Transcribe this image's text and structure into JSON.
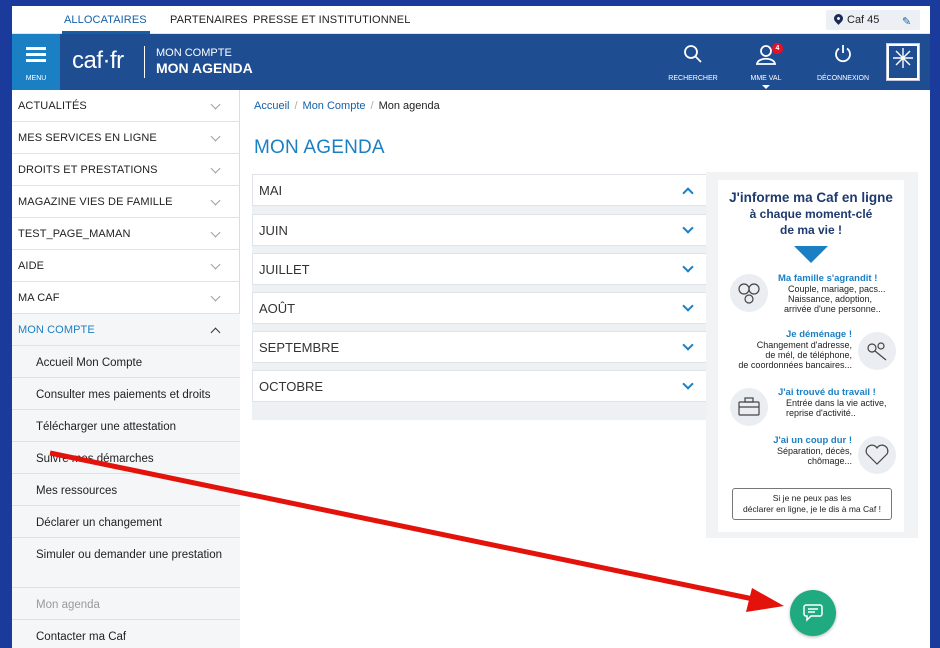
{
  "topbar": {
    "links": [
      "ALLOCATAIRES",
      "PARTENAIRES",
      "PRESSE ET INSTITUTIONNEL"
    ],
    "caf_selector": "Caf 45"
  },
  "header": {
    "menu_label": "MENU",
    "logo": "caf·fr",
    "subtitle": "MON COMPTE",
    "title": "MON AGENDA",
    "search_label": "RECHERCHER",
    "user_label": "MME VAL",
    "notif_count": "4",
    "logout_label": "DÉCONNEXION"
  },
  "sidebar": {
    "items": [
      "ACTUALITÉS",
      "MES SERVICES EN LIGNE",
      "DROITS ET PRESTATIONS",
      "MAGAZINE VIES DE FAMILLE",
      "TEST_PAGE_MAMAN",
      "AIDE",
      "MA CAF",
      "MON COMPTE"
    ],
    "subitems": [
      "Accueil Mon Compte",
      "Consulter mes paiements et droits",
      "Télécharger une attestation",
      "Suivre mes démarches",
      "Mes ressources",
      "Déclarer un changement",
      "Simuler ou demander une prestation",
      "Mon agenda",
      "Contacter ma Caf"
    ]
  },
  "breadcrumb": {
    "home": "Accueil",
    "account": "Mon Compte",
    "current": "Mon agenda"
  },
  "page_title": "MON AGENDA",
  "months": [
    "MAI",
    "JUIN",
    "JUILLET",
    "AOÛT",
    "SEPTEMBRE",
    "OCTOBRE"
  ],
  "promo": {
    "title_l1": "J'informe ma Caf en ligne",
    "title_l2": "à chaque moment-clé",
    "title_l3": "de ma vie !",
    "famille_title": "Ma famille s'agrandit !",
    "famille_l1": "Couple, mariage, pacs...",
    "famille_l2": "Naissance, adoption,",
    "famille_l3": "arrivée d'une personne..",
    "demenage_title": "Je déménage !",
    "demenage_l1": "Changement d'adresse,",
    "demenage_l2": "de mél, de téléphone,",
    "demenage_l3": "de coordonnées bancaires...",
    "travail_title": "J'ai trouvé du travail !",
    "travail_l1": "Entrée dans la vie active,",
    "travail_l2": "reprise d'activité..",
    "dur_title": "J'ai un coup dur !",
    "dur_l1": "Séparation, décès,",
    "dur_l2": "chômage...",
    "button_l1": "Si je ne peux pas les",
    "button_l2": "déclarer en ligne, je le dis à ma Caf !"
  },
  "colors": {
    "brand_blue": "#1e4d92",
    "accent_blue": "#1b7fc4",
    "chat_green": "#1faa7f",
    "arrow_red": "#e3120b"
  }
}
